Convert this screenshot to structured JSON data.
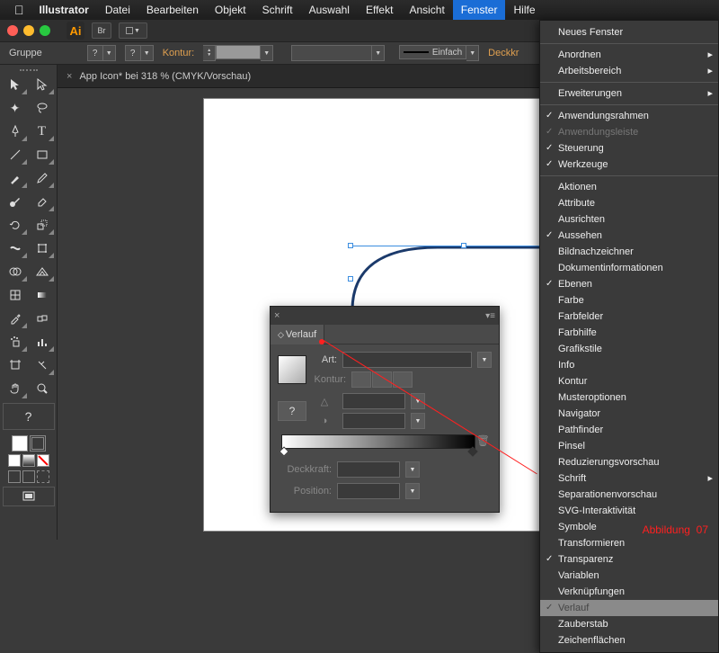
{
  "menubar": {
    "app": "Illustrator",
    "items": [
      "Datei",
      "Bearbeiten",
      "Objekt",
      "Schrift",
      "Auswahl",
      "Effekt",
      "Ansicht",
      "Fenster",
      "Hilfe"
    ],
    "active": "Fenster"
  },
  "controlbar": {
    "selection_label": "Gruppe",
    "kontur_label": "Kontur:",
    "stroke_weight": "?",
    "stroke_style": "Einfach",
    "opacity_label": "Deckkr"
  },
  "document": {
    "tab_title": "App Icon* bei 318 % (CMYK/Vorschau)"
  },
  "tools": {
    "question": "?"
  },
  "panel": {
    "title": "Verlauf",
    "art_label": "Art:",
    "kontur_label": "Kontur:",
    "angle_icon": "△",
    "ratio_icon": "◑",
    "deckkraft_label": "Deckkraft:",
    "position_label": "Position:",
    "question": "?"
  },
  "dropdown": {
    "group1": [
      {
        "label": "Neues Fenster"
      }
    ],
    "group2": [
      {
        "label": "Anordnen",
        "arrow": true
      },
      {
        "label": "Arbeitsbereich",
        "arrow": true
      }
    ],
    "group3": [
      {
        "label": "Erweiterungen",
        "arrow": true
      }
    ],
    "group4": [
      {
        "label": "Anwendungsrahmen",
        "checked": true
      },
      {
        "label": "Anwendungsleiste",
        "checked": true,
        "disabled": true
      },
      {
        "label": "Steuerung",
        "checked": true
      },
      {
        "label": "Werkzeuge",
        "checked": true
      }
    ],
    "group5": [
      {
        "label": "Aktionen"
      },
      {
        "label": "Attribute"
      },
      {
        "label": "Ausrichten"
      },
      {
        "label": "Aussehen",
        "checked": true
      },
      {
        "label": "Bildnachzeichner"
      },
      {
        "label": "Dokumentinformationen"
      },
      {
        "label": "Ebenen",
        "checked": true
      },
      {
        "label": "Farbe"
      },
      {
        "label": "Farbfelder"
      },
      {
        "label": "Farbhilfe"
      },
      {
        "label": "Grafikstile"
      },
      {
        "label": "Info"
      },
      {
        "label": "Kontur"
      },
      {
        "label": "Musteroptionen"
      },
      {
        "label": "Navigator"
      },
      {
        "label": "Pathfinder"
      },
      {
        "label": "Pinsel"
      },
      {
        "label": "Reduzierungsvorschau"
      },
      {
        "label": "Schrift",
        "arrow": true
      },
      {
        "label": "Separationenvorschau"
      },
      {
        "label": "SVG-Interaktivität"
      },
      {
        "label": "Symbole"
      },
      {
        "label": "Transformieren"
      },
      {
        "label": "Transparenz",
        "checked": true
      },
      {
        "label": "Variablen"
      },
      {
        "label": "Verknüpfungen"
      },
      {
        "label": "Verlauf",
        "checked": true,
        "highlighted": true
      },
      {
        "label": "Zauberstab"
      },
      {
        "label": "Zeichenflächen"
      }
    ]
  },
  "annotation": {
    "label": "Abbildung",
    "number": "07"
  }
}
